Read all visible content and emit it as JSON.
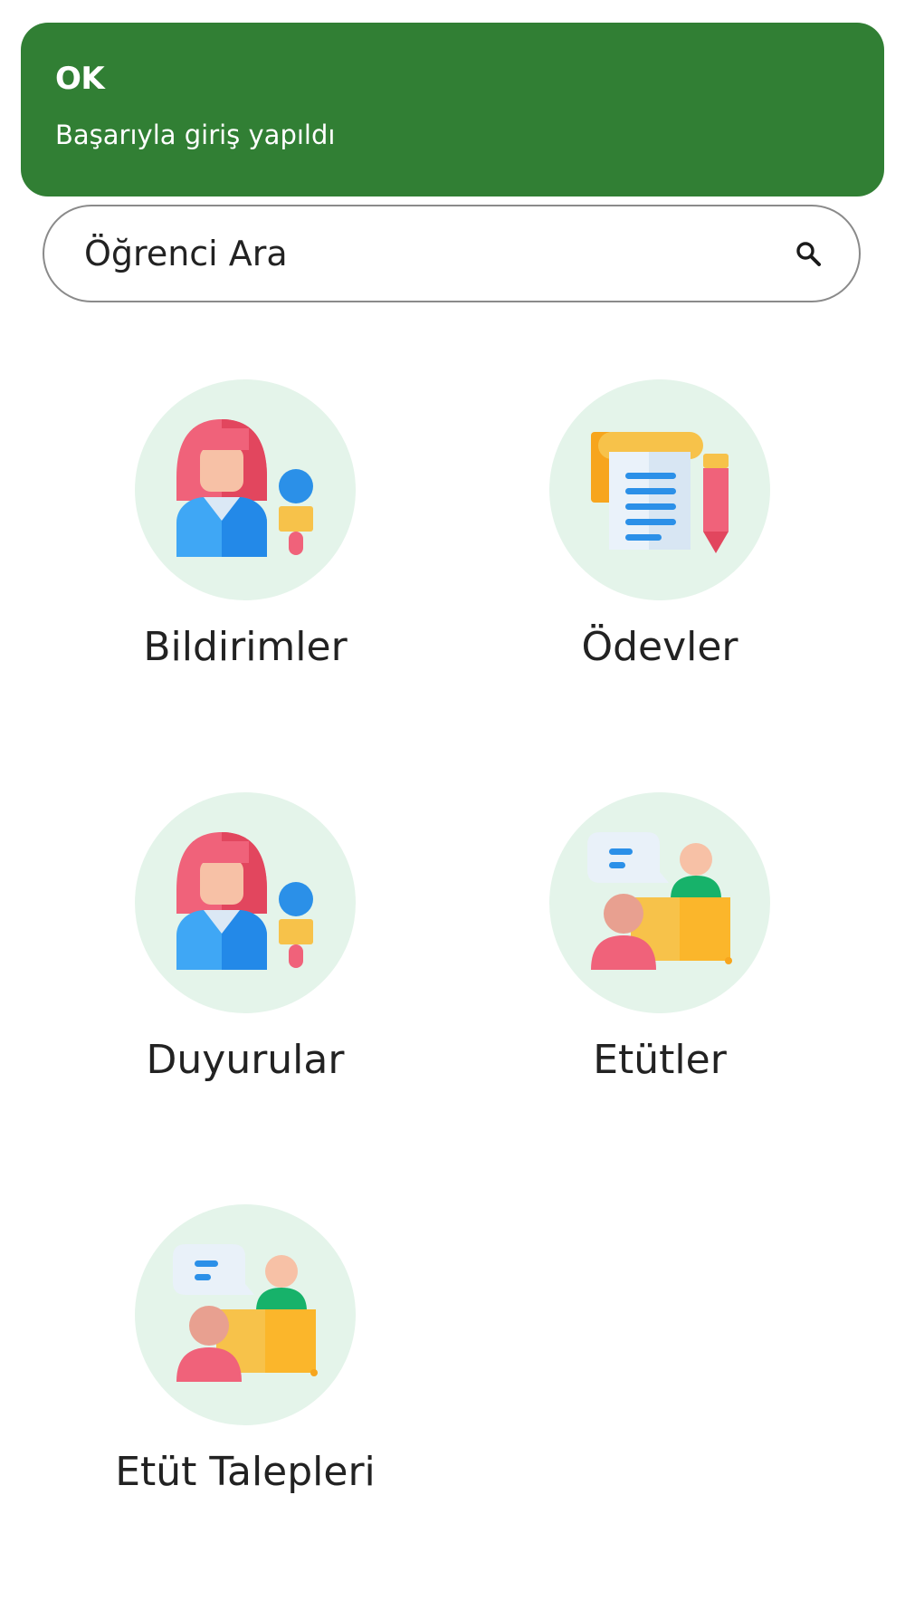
{
  "colors": {
    "toast_bg": "#317f34",
    "circle_bg": "#e4f4ea",
    "text": "#222222"
  },
  "toast": {
    "title": "OK",
    "message": "Başarıyla giriş yapıldı"
  },
  "search": {
    "placeholder": "Öğrenci Ara",
    "icon": "search-icon"
  },
  "menu": [
    {
      "label": "Bildirimler",
      "icon": "presenter-microphone-icon"
    },
    {
      "label": "Ödevler",
      "icon": "homework-document-icon"
    },
    {
      "label": "Duyurular",
      "icon": "presenter-microphone-icon"
    },
    {
      "label": "Etütler",
      "icon": "study-session-icon"
    },
    {
      "label": "Etüt Talepleri",
      "icon": "study-session-icon"
    }
  ]
}
